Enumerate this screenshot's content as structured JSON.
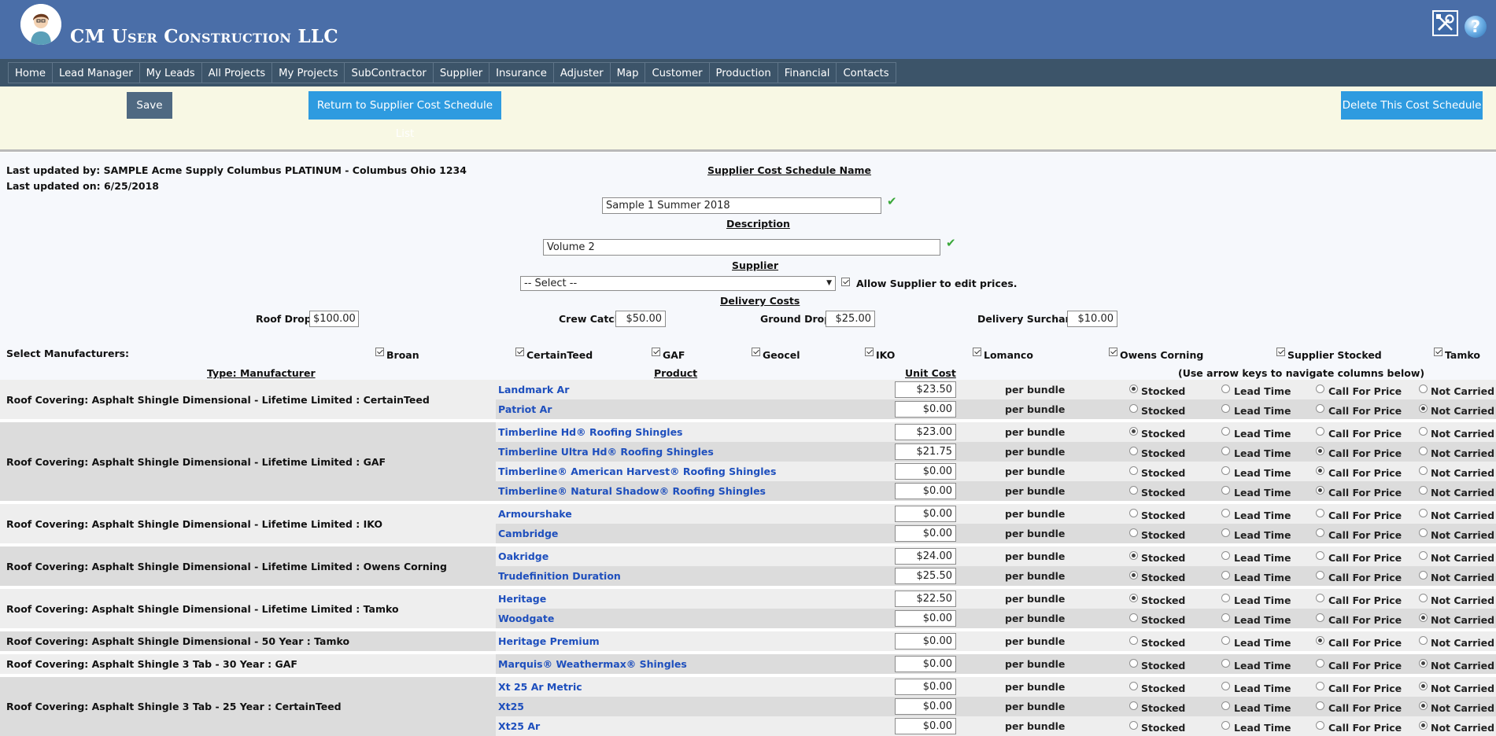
{
  "header": {
    "company": "CM User Construction LLC",
    "help_glyph": "?"
  },
  "nav": [
    "Home",
    "Lead Manager",
    "My Leads",
    "All Projects",
    "My Projects",
    "SubContractor",
    "Supplier",
    "Insurance",
    "Adjuster",
    "Map",
    "Customer",
    "Production",
    "Financial",
    "Contacts"
  ],
  "actions": {
    "save": "Save",
    "return": "Return to Supplier Cost Schedule List",
    "delete": "Delete This Cost Schedule"
  },
  "info": {
    "last_updated_by": "Last updated by: SAMPLE Acme Supply Columbus PLATINUM - Columbus Ohio 1234",
    "last_updated_on": "Last updated on: 6/25/2018"
  },
  "form": {
    "name_label": "Supplier Cost Schedule Name",
    "name_value": "Sample 1 Summer 2018",
    "desc_label": "Description",
    "desc_value": "Volume 2",
    "supplier_label": "Supplier",
    "supplier_value": "-- Select --",
    "allow_edit_label": "Allow Supplier to edit prices.",
    "delivery_label": "Delivery Costs",
    "roof_drop_label": "Roof Drop:",
    "roof_drop": "$100.00",
    "crew_catch_label": "Crew Catch:",
    "crew_catch": "$50.00",
    "ground_drop_label": "Ground Drop:",
    "ground_drop": "$25.00",
    "surcharge_label": "Delivery Surcharge:",
    "surcharge": "$10.00",
    "manufacturers_label": "Select Manufacturers:",
    "manufacturers": [
      "Broan",
      "CertainTeed",
      "GAF",
      "Geocel",
      "IKO",
      "Lomanco",
      "Owens Corning",
      "Supplier Stocked",
      "Tamko"
    ]
  },
  "table": {
    "headers": {
      "type": "Type: Manufacturer",
      "product": "Product",
      "unit_cost": "Unit Cost",
      "hint": "(Use arrow keys to navigate columns below)"
    },
    "status_labels": [
      "Stocked",
      "Lead Time",
      "Call For Price",
      "Not Carried"
    ],
    "groups": [
      {
        "label": "Roof Covering: Asphalt Shingle Dimensional - Lifetime Limited : CertainTeed",
        "rows": [
          {
            "product": "Landmark Ar",
            "cost": "$23.50",
            "unit": "per bundle",
            "status": 0
          },
          {
            "product": "Patriot Ar",
            "cost": "$0.00",
            "unit": "per bundle",
            "status": 3
          }
        ]
      },
      {
        "label": "Roof Covering: Asphalt Shingle Dimensional - Lifetime Limited : GAF",
        "rows": [
          {
            "product": "Timberline Hd® Roofing Shingles",
            "cost": "$23.00",
            "unit": "per bundle",
            "status": 0
          },
          {
            "product": "Timberline Ultra Hd® Roofing Shingles",
            "cost": "$21.75",
            "unit": "per bundle",
            "status": 2
          },
          {
            "product": "Timberline® American Harvest® Roofing Shingles",
            "cost": "$0.00",
            "unit": "per bundle",
            "status": 2
          },
          {
            "product": "Timberline® Natural Shadow® Roofing Shingles",
            "cost": "$0.00",
            "unit": "per bundle",
            "status": 2
          }
        ]
      },
      {
        "label": "Roof Covering: Asphalt Shingle Dimensional - Lifetime Limited : IKO",
        "rows": [
          {
            "product": "Armourshake",
            "cost": "$0.00",
            "unit": "per bundle",
            "status": -1
          },
          {
            "product": "Cambridge",
            "cost": "$0.00",
            "unit": "per bundle",
            "status": -1
          }
        ]
      },
      {
        "label": "Roof Covering: Asphalt Shingle Dimensional - Lifetime Limited : Owens Corning",
        "rows": [
          {
            "product": "Oakridge",
            "cost": "$24.00",
            "unit": "per bundle",
            "status": 0
          },
          {
            "product": "Trudefinition Duration",
            "cost": "$25.50",
            "unit": "per bundle",
            "status": 0
          }
        ]
      },
      {
        "label": "Roof Covering: Asphalt Shingle Dimensional - Lifetime Limited : Tamko",
        "rows": [
          {
            "product": "Heritage",
            "cost": "$22.50",
            "unit": "per bundle",
            "status": 0
          },
          {
            "product": "Woodgate",
            "cost": "$0.00",
            "unit": "per bundle",
            "status": 3
          }
        ]
      },
      {
        "label": "Roof Covering: Asphalt Shingle Dimensional - 50 Year : Tamko",
        "rows": [
          {
            "product": "Heritage Premium",
            "cost": "$0.00",
            "unit": "per bundle",
            "status": 2
          }
        ]
      },
      {
        "label": "Roof Covering: Asphalt Shingle 3 Tab - 30 Year : GAF",
        "rows": [
          {
            "product": "Marquis® Weathermax® Shingles",
            "cost": "$0.00",
            "unit": "per bundle",
            "status": 3
          }
        ]
      },
      {
        "label": "Roof Covering: Asphalt Shingle 3 Tab - 25 Year : CertainTeed",
        "rows": [
          {
            "product": "Xt 25 Ar Metric",
            "cost": "$0.00",
            "unit": "per bundle",
            "status": 3
          },
          {
            "product": "Xt25",
            "cost": "$0.00",
            "unit": "per bundle",
            "status": 3
          },
          {
            "product": "Xt25 Ar",
            "cost": "$0.00",
            "unit": "per bundle",
            "status": 3
          }
        ]
      }
    ]
  }
}
